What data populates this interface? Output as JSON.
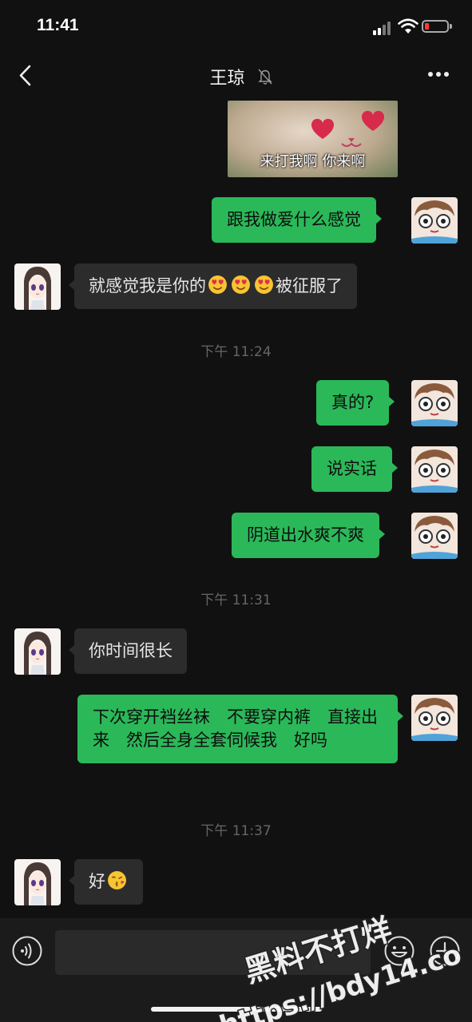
{
  "status_bar": {
    "time": "11:41"
  },
  "header": {
    "title": "王琼"
  },
  "image_message": {
    "caption": "来打我啊 你来啊"
  },
  "messages": [
    {
      "text": "跟我做爱什么感觉"
    },
    {
      "text_before": "就感觉我是你的",
      "emojis": [
        "heart-eyes-emoji",
        "heart-eyes-emoji",
        "heart-eyes-emoji"
      ],
      "text_after": "被征服了"
    },
    {
      "text": "真的?"
    },
    {
      "text": "说实话"
    },
    {
      "text": "阴道出水爽不爽"
    },
    {
      "text": "你时间很长"
    },
    {
      "text": "下次穿开裆丝袜　不要穿内裤　直接出来　然后全身全套伺候我　好吗"
    },
    {
      "text": "好",
      "emoji": "kissing-emoji"
    }
  ],
  "timestamps": [
    "下午 11:24",
    "下午 11:31",
    "下午 11:37"
  ],
  "watermark": {
    "line1": "黑料不打烊",
    "line2": "https://bdy14.co"
  },
  "colors": {
    "outgoing_bubble": "#2bb859",
    "incoming_bubble": "#2c2c2c",
    "background": "#111111"
  }
}
